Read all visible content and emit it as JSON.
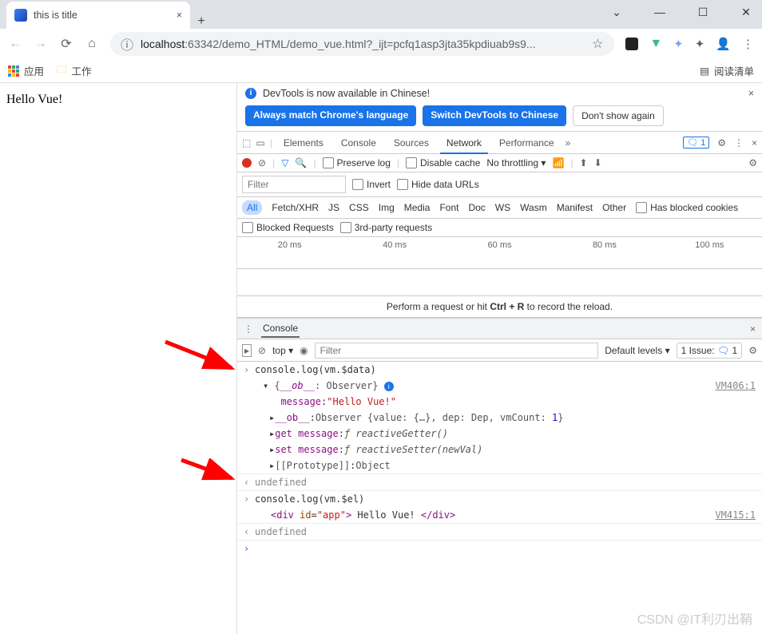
{
  "tab": {
    "title": "this is title"
  },
  "url": {
    "host": "localhost",
    "rest": ":63342/demo_HTML/demo_vue.html?_ijt=pcfq1asp3jta35kpdiuab9s9..."
  },
  "bookmarks": {
    "apps": "应用",
    "work": "工作",
    "readlist": "阅读清单"
  },
  "page": {
    "text": "Hello Vue!"
  },
  "infobar": {
    "msg": "DevTools is now available in Chinese!",
    "btn1": "Always match Chrome's language",
    "btn2": "Switch DevTools to Chinese",
    "btn3": "Don't show again"
  },
  "dt_tabs": {
    "t1": "Elements",
    "t2": "Console",
    "t3": "Sources",
    "t4": "Network",
    "t5": "Performance"
  },
  "nw": {
    "preserve": "Preserve log",
    "disable": "Disable cache",
    "throttle": "No throttling",
    "filter_ph": "Filter",
    "invert": "Invert",
    "hide": "Hide data URLs",
    "types": {
      "all": "All",
      "fetch": "Fetch/XHR",
      "js": "JS",
      "css": "CSS",
      "img": "Img",
      "media": "Media",
      "font": "Font",
      "doc": "Doc",
      "ws": "WS",
      "wasm": "Wasm",
      "manifest": "Manifest",
      "other": "Other"
    },
    "blocked_cookies": "Has blocked cookies",
    "blocked_req": "Blocked Requests",
    "thirdparty": "3rd-party requests",
    "times": {
      "t1": "20 ms",
      "t2": "40 ms",
      "t3": "60 ms",
      "t4": "80 ms",
      "t5": "100 ms"
    },
    "hint_a": "Perform a request or hit ",
    "hint_b": "Ctrl + R",
    "hint_c": " to record the reload."
  },
  "drawer": {
    "tab": "Console",
    "ctx": "top",
    "filter_ph": "Filter",
    "levels": "Default levels",
    "issues_lbl": "1 Issue:",
    "issues_n": "1",
    "badge": "1"
  },
  "console": {
    "l1": "console.log(vm.$data)",
    "obj_header_a": "{",
    "obj_header_b": "__ob__",
    "obj_header_c": ": Observer",
    "obj_header_d": "}",
    "src1": "VM406:1",
    "msg_k": "message",
    "msg_v": "\"Hello Vue!\"",
    "ob_k": "__ob__",
    "ob_v_a": "Observer {value: {…}, dep: Dep, vmCount: ",
    "ob_v_n": "1",
    "ob_v_b": "}",
    "get_k": "get message",
    "get_v": " reactiveGetter()",
    "set_k": "set message",
    "set_v": " reactiveSetter(",
    "set_arg": "newVal",
    "set_v2": ")",
    "proto": "[[Prototype]]",
    "proto_v": "Object",
    "undef": "undefined",
    "l2": "console.log(vm.$el)",
    "src2": "VM415:1",
    "el_a": "<div ",
    "el_attr": "id",
    "el_eq": "=",
    "el_val": "\"app\"",
    "el_b": ">",
    "el_txt": " Hello Vue! ",
    "el_c": "</div>"
  },
  "watermark": "CSDN @IT利刃出鞘"
}
